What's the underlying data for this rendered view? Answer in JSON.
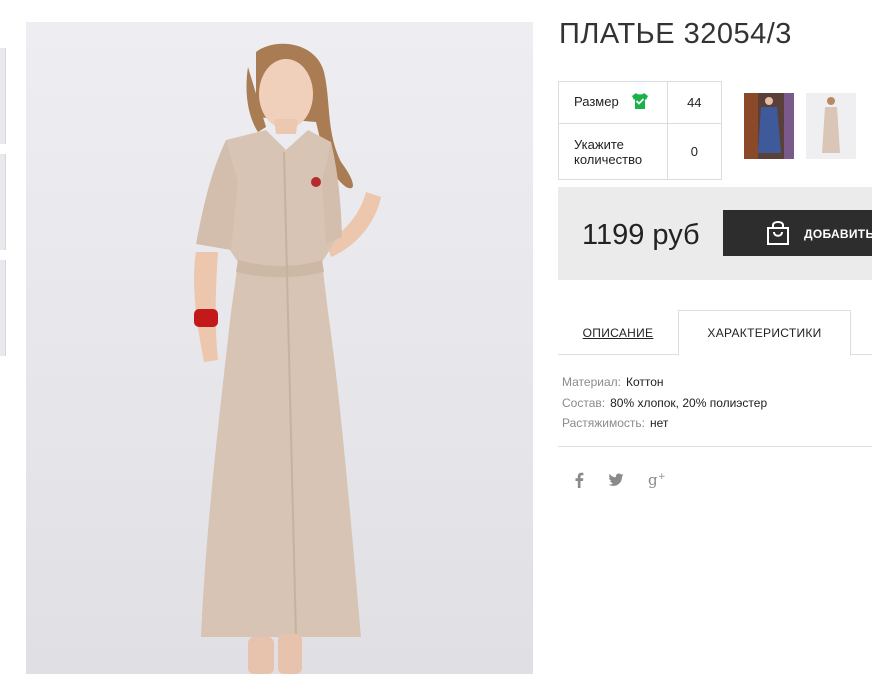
{
  "product": {
    "title": "ПЛАТЬЕ 32054/3",
    "options": {
      "size_label": "Размер",
      "size_value": "44",
      "qty_label": "Укажите количество",
      "qty_value": "0"
    },
    "price": "1199 руб",
    "add_button": "ДОБАВИТЬ"
  },
  "tabs": [
    {
      "label": "ОПИСАНИЕ"
    },
    {
      "label": "ХАРАКТЕРИСТИКИ"
    }
  ],
  "specs": [
    {
      "key": "Материал:",
      "value": "Коттон"
    },
    {
      "key": "Состав:",
      "value": "80% хлопок, 20% полиэстер"
    },
    {
      "key": "Растяжимость:",
      "value": "нет"
    }
  ],
  "social": {
    "facebook": "f",
    "twitter": "t",
    "googleplus": "g+"
  },
  "colors": {
    "size_icon": "#19b34a",
    "button_bg": "#2d2d2d",
    "price_bg": "#ebebeb",
    "dress": "#d8c4b4"
  },
  "icons": [
    "tshirt-check-icon",
    "shopping-bag-icon",
    "facebook-icon",
    "twitter-icon",
    "google-plus-icon"
  ]
}
